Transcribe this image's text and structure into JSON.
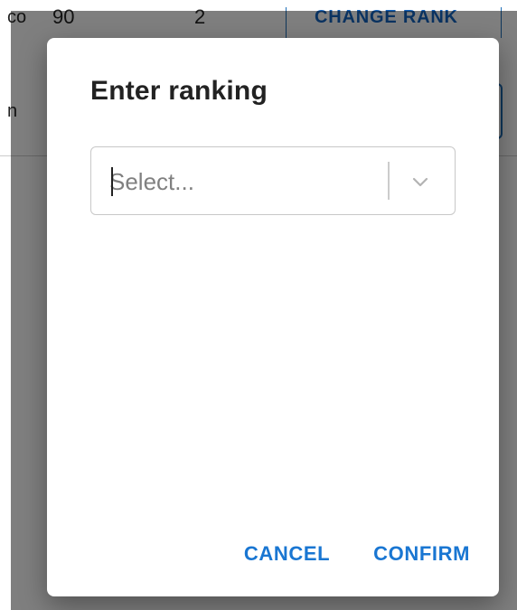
{
  "background": {
    "row": {
      "cell_1": "co",
      "cell_2": "90",
      "cell_3": "2",
      "action_label": "CHANGE RANK"
    },
    "row2_left_glyph": "n"
  },
  "dialog": {
    "title": "Enter ranking",
    "select": {
      "placeholder": "Select...",
      "icon": "chevron-down-icon"
    },
    "actions": {
      "cancel_label": "CANCEL",
      "confirm_label": "CONFIRM"
    }
  },
  "colors": {
    "accent": "#1976d2",
    "backdrop": "rgba(0,0,0,0.5)",
    "title_text": "#222222",
    "placeholder_text": "#808080"
  }
}
